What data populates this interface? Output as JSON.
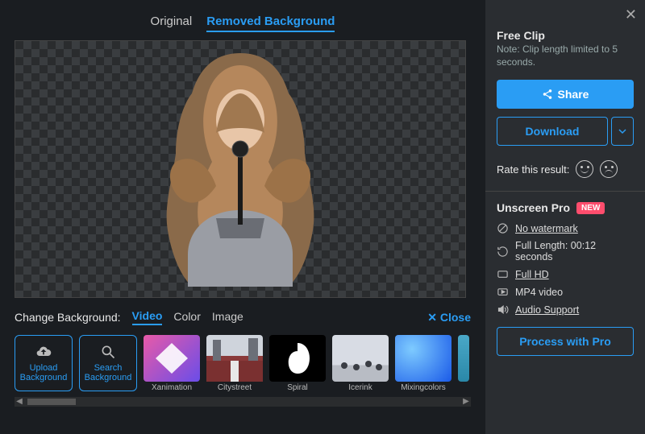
{
  "tabs": {
    "original": "Original",
    "removed": "Removed Background"
  },
  "bg": {
    "label": "Change Background:",
    "options": {
      "video": "Video",
      "color": "Color",
      "image": "Image"
    },
    "close": "Close",
    "upload": "Upload Background",
    "search": "Search Background",
    "thumbs": [
      "Xanimation",
      "Citystreet",
      "Spiral",
      "Icerink",
      "Mixingcolors"
    ]
  },
  "sidebar": {
    "free_title": "Free Clip",
    "note": "Note: Clip length limited to 5 seconds.",
    "share": "Share",
    "download": "Download",
    "rate": "Rate this result:",
    "pro_title": "Unscreen Pro",
    "new_badge": "NEW",
    "features": {
      "no_watermark": "No watermark",
      "full_length": "Full Length: 00:12 seconds",
      "full_hd": "Full HD",
      "mp4": "MP4 video",
      "audio": "Audio Support"
    },
    "process": "Process with Pro"
  }
}
